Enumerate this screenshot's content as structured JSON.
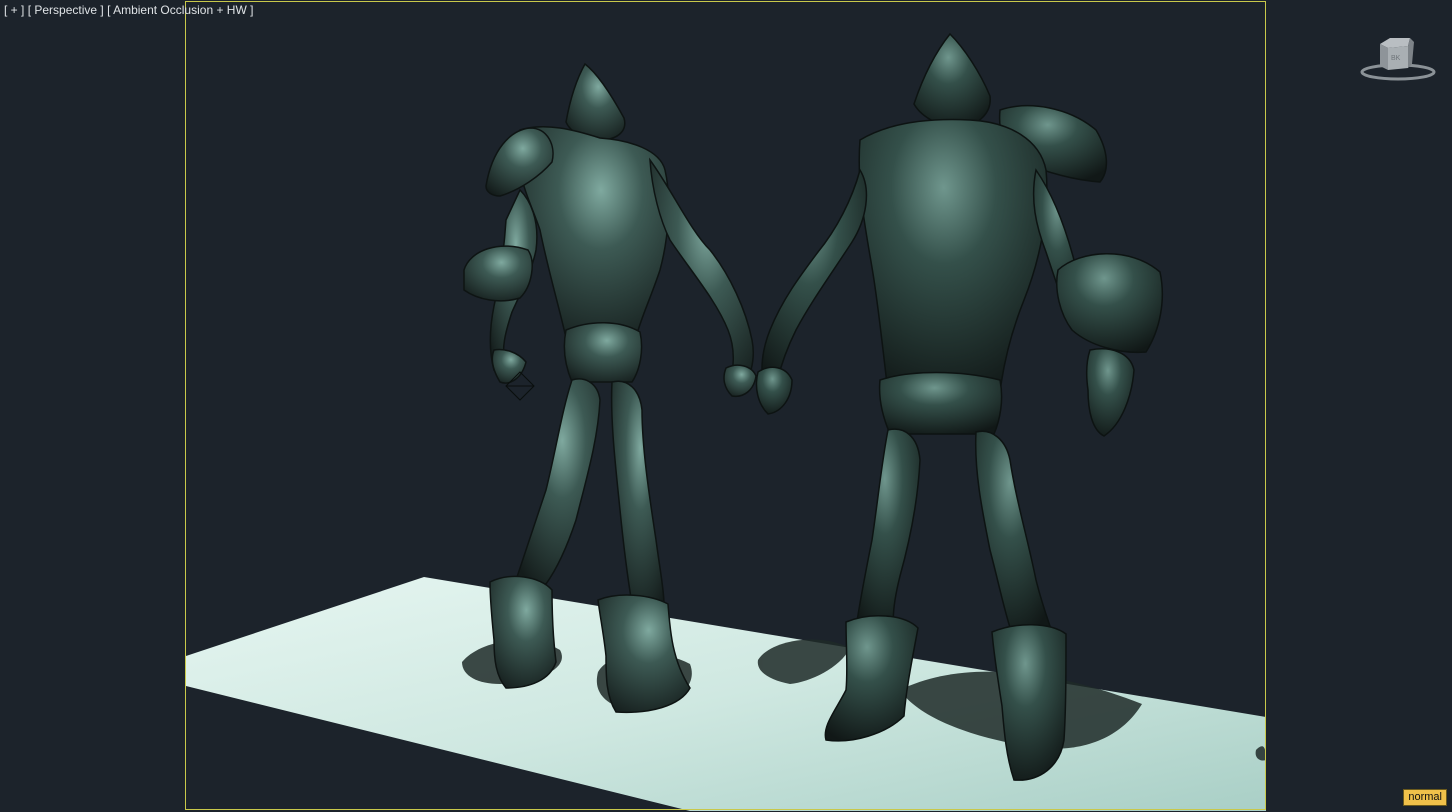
{
  "viewport": {
    "label_plus": "[ + ]",
    "label_view": "[ Perspective ]",
    "label_shading": "[ Ambient Occlusion + HW ]",
    "mode_badge": "normal",
    "colors": {
      "background": "#1c232b",
      "frame": "#c8c84a",
      "ground": "#d8eee8",
      "character": "#2f403d",
      "badge": "#f0c14a"
    }
  },
  "viewcube": {
    "icon": "viewcube-icon"
  }
}
